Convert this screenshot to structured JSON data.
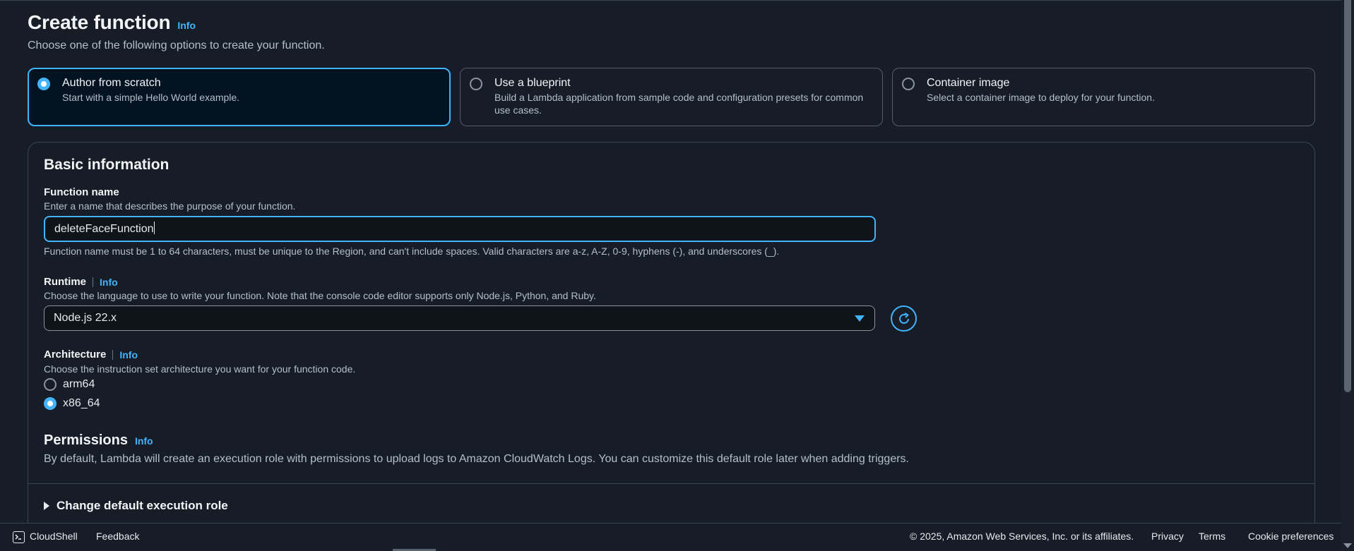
{
  "header": {
    "title": "Create function",
    "info": "Info",
    "subtitle": "Choose one of the following options to create your function."
  },
  "options": [
    {
      "title": "Author from scratch",
      "desc": "Start with a simple Hello World example.",
      "selected": true
    },
    {
      "title": "Use a blueprint",
      "desc": "Build a Lambda application from sample code and configuration presets for common use cases.",
      "selected": false
    },
    {
      "title": "Container image",
      "desc": "Select a container image to deploy for your function.",
      "selected": false
    }
  ],
  "basic_info": {
    "title": "Basic information",
    "function_name": {
      "label": "Function name",
      "desc": "Enter a name that describes the purpose of your function.",
      "value": "deleteFaceFunction",
      "constraint": "Function name must be 1 to 64 characters, must be unique to the Region, and can't include spaces. Valid characters are a-z, A-Z, 0-9, hyphens (-), and underscores (_)."
    },
    "runtime": {
      "label": "Runtime",
      "info": "Info",
      "desc": "Choose the language to use to write your function. Note that the console code editor supports only Node.js, Python, and Ruby.",
      "value": "Node.js 22.x"
    },
    "architecture": {
      "label": "Architecture",
      "info": "Info",
      "desc": "Choose the instruction set architecture you want for your function code.",
      "options": [
        {
          "label": "arm64",
          "checked": false
        },
        {
          "label": "x86_64",
          "checked": true
        }
      ]
    },
    "permissions": {
      "title": "Permissions",
      "info": "Info",
      "desc": "By default, Lambda will create an execution role with permissions to upload logs to Amazon CloudWatch Logs. You can customize this default role later when adding triggers."
    },
    "expander": "Change default execution role"
  },
  "footer": {
    "cloudshell": "CloudShell",
    "feedback": "Feedback",
    "copyright": "© 2025, Amazon Web Services, Inc. or its affiliates.",
    "privacy": "Privacy",
    "terms": "Terms",
    "cookies": "Cookie preferences"
  },
  "colors": {
    "background": "#161d26",
    "accent": "#42b4ff",
    "selected_card": "#041322"
  }
}
